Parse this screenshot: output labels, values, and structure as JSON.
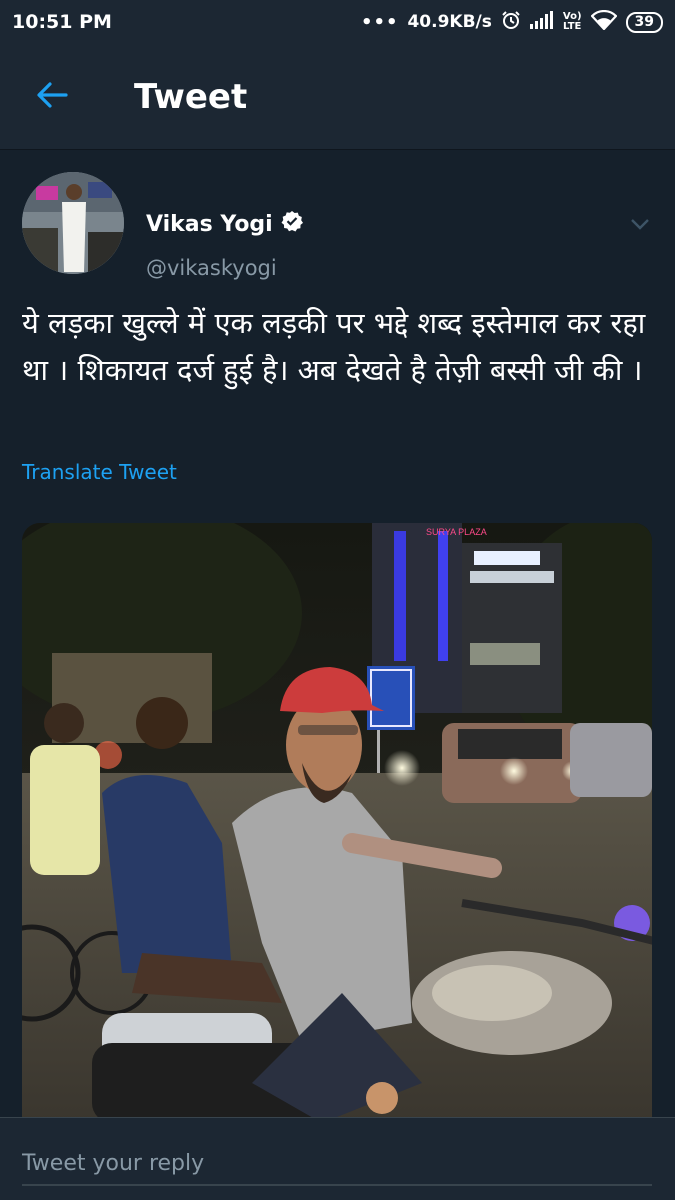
{
  "status_bar": {
    "time": "10:51 PM",
    "dots": "•••",
    "network_speed": "40.9KB/s",
    "lte_top": "Vo)",
    "lte_bottom": "LTE",
    "battery": "39",
    "icons": [
      "alarm-icon",
      "signal-icon",
      "wifi-icon",
      "battery-icon"
    ]
  },
  "header": {
    "back_icon": "arrow-left-icon",
    "title": "Tweet"
  },
  "tweet": {
    "author_name": "Vikas Yogi",
    "verified": true,
    "handle": "@vikaskyogi",
    "text": "ये लड़का खुल्ले में एक लड़की पर भद्दे शब्द इस्तेमाल कर रहा था । शिकायत दर्ज हुई है। अब देखते है तेज़ी बस्सी जी की ।",
    "translate_label": "Translate Tweet",
    "media": {
      "type": "photo",
      "sign_text": "SURYA PLAZA"
    }
  },
  "reply": {
    "placeholder": "Tweet your reply"
  },
  "colors": {
    "background": "#15202b",
    "bar": "#1c2733",
    "accent": "#1da1f2",
    "muted": "#8899a6"
  }
}
